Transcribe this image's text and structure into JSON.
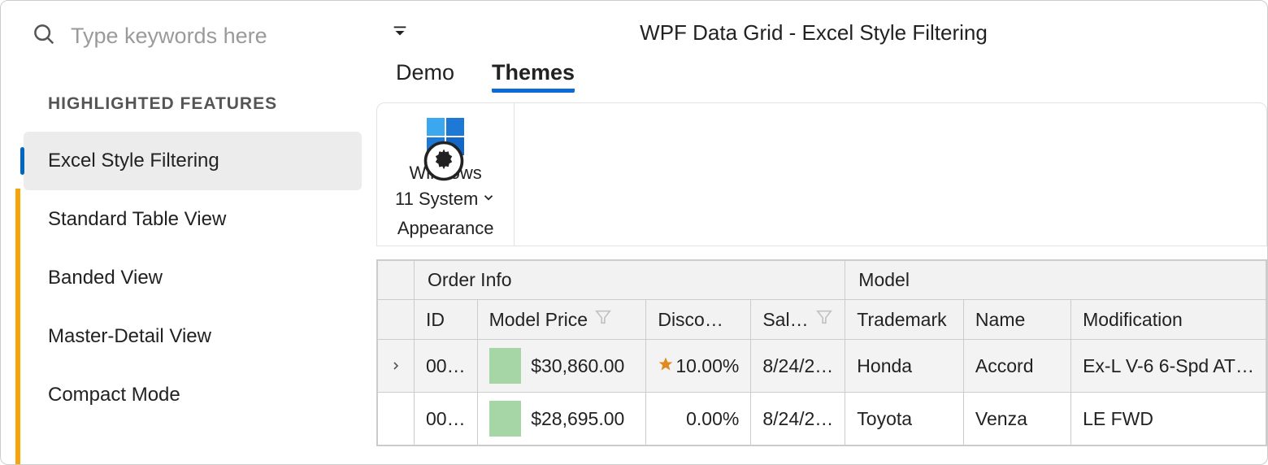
{
  "search": {
    "placeholder": "Type keywords here"
  },
  "sidebar": {
    "section_title": "HIGHLIGHTED FEATURES",
    "items": [
      {
        "label": "Excel Style Filtering",
        "selected": true
      },
      {
        "label": "Standard Table View"
      },
      {
        "label": "Banded View"
      },
      {
        "label": "Master-Detail View"
      },
      {
        "label": "Compact Mode"
      }
    ]
  },
  "header": {
    "title": "WPF Data Grid - Excel Style Filtering",
    "tabs": [
      "Demo",
      "Themes"
    ],
    "active_tab": 1
  },
  "ribbon": {
    "theme_button": {
      "line1": "Windows",
      "line2": "11 System"
    },
    "group_title": "Appearance"
  },
  "grid": {
    "bands": [
      "Order Info",
      "Model"
    ],
    "columns": [
      "ID",
      "Model Price",
      "Disco…",
      "Sal…",
      "Trademark",
      "Name",
      "Modification"
    ],
    "rows": [
      {
        "selected": true,
        "expander": true,
        "id": "00…",
        "price": "$30,860.00",
        "price_bar_pct": 41,
        "discount": "10.00%",
        "starred": true,
        "date": "8/24/2…",
        "trademark": "Honda",
        "name": "Accord",
        "modification": "Ex-L V-6 6-Spd AT…"
      },
      {
        "selected": false,
        "expander": false,
        "id": "00…",
        "price": "$28,695.00",
        "price_bar_pct": 38,
        "discount": "0.00%",
        "starred": false,
        "date": "8/24/2…",
        "trademark": "Toyota",
        "name": "Venza",
        "modification": "LE FWD"
      }
    ]
  },
  "colors": {
    "accent_blue": "#0b6cd7",
    "accent_orange": "#f7a30a",
    "bar_green": "#a6d6a6"
  }
}
